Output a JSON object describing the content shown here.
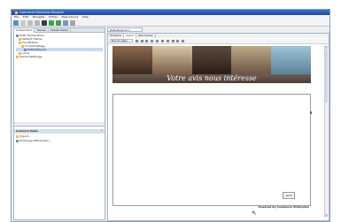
{
  "window": {
    "title": "Commerce Enterprise Designer",
    "accent_color": "#2d5fbf"
  },
  "menubar": {
    "items": [
      "File",
      "Edit",
      "Navigate",
      "Extras",
      "Page Layout",
      "Help"
    ]
  },
  "toolbar": {
    "icons": [
      "new-icon",
      "delete-icon",
      "cut-icon",
      "copy-icon",
      "search-icon",
      "back-icon",
      "forward-icon",
      "save-icon",
      "refresh-icon"
    ]
  },
  "left_panel": {
    "tabs": [
      "Content Items",
      "Themes",
      "Website Details"
    ],
    "tree": [
      {
        "label": "Multi Theme Store",
        "level": 0
      },
      {
        "label": "Default Theme",
        "level": 1
      },
      {
        "label": "FormBuilder",
        "level": 1
      },
      {
        "label": "ContactUsPage",
        "level": 2
      },
      {
        "label": "DefaultLayout",
        "level": 3,
        "selected": true
      },
      {
        "label": "Lotus",
        "level": 1
      },
      {
        "label": "Shared Webpage",
        "level": 0
      }
    ],
    "tasks_title": "Common Tasks",
    "tasks": [
      "Import...",
      "Exchange Offline Item..."
    ]
  },
  "document": {
    "tab_label": "DefaultLayout",
    "view_tabs": [
      "Properties",
      "Layout",
      "Web Preview"
    ],
    "style_select": "Normal (Web)",
    "banner_text": "Votre avis nous intéresse",
    "send_label": "send",
    "powered_by": "Powered by Commerce Enterprise"
  }
}
